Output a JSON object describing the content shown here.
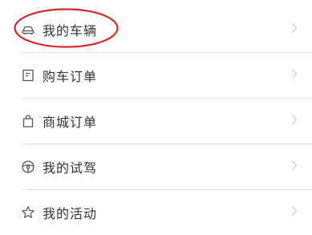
{
  "menu": {
    "items": [
      {
        "label": "我的车辆",
        "icon": "car-icon"
      },
      {
        "label": "购车订单",
        "icon": "order-document-icon"
      },
      {
        "label": "商城订单",
        "icon": "shopping-bag-icon"
      },
      {
        "label": "我的试驾",
        "icon": "steering-wheel-icon"
      },
      {
        "label": "我的活动",
        "icon": "star-icon"
      }
    ],
    "chevron_icon": "chevron-right-icon"
  },
  "annotation": {
    "highlight_color": "#d42a2a",
    "target_item": "我的车辆"
  },
  "colors": {
    "text": "#333333",
    "icon": "#555555",
    "divider": "#e6e6e6",
    "chevron": "#c8c8c8"
  }
}
